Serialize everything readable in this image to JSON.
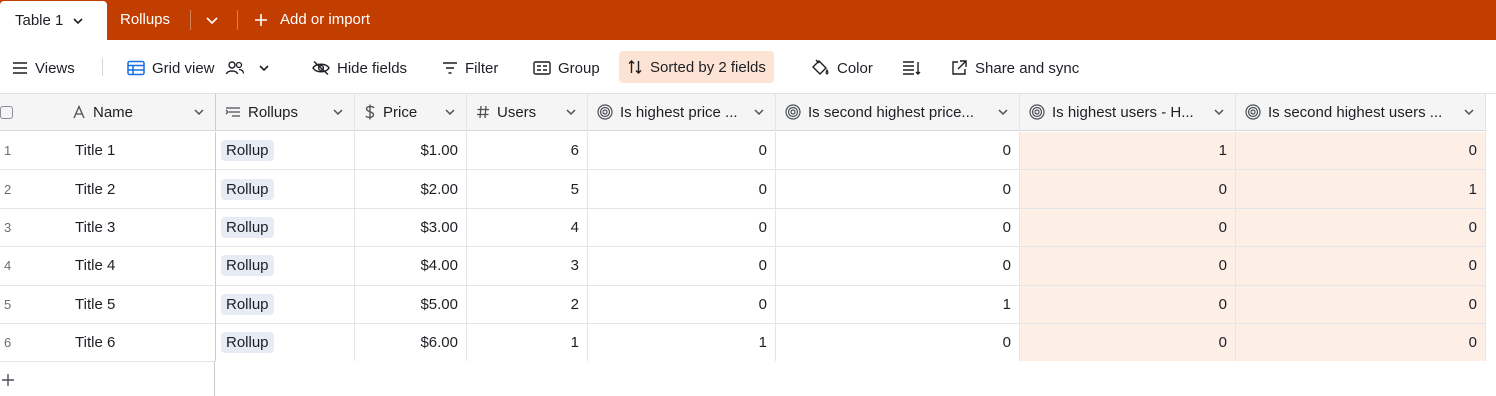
{
  "tabs": {
    "active": "Table 1",
    "inactive": "Rollups",
    "add_import": "Add or import"
  },
  "toolbar": {
    "views": "Views",
    "grid_view": "Grid view",
    "hide_fields": "Hide fields",
    "filter": "Filter",
    "group": "Group",
    "sorted": "Sorted by 2 fields",
    "color": "Color",
    "share_sync": "Share and sync"
  },
  "columns": [
    {
      "label": "Name",
      "icon": "text-icon"
    },
    {
      "label": "Rollups",
      "icon": "link-icon"
    },
    {
      "label": "Price",
      "icon": "currency-icon"
    },
    {
      "label": "Users",
      "icon": "number-icon"
    },
    {
      "label": "Is highest price ...",
      "icon": "formula-icon"
    },
    {
      "label": "Is second highest price...",
      "icon": "formula-icon"
    },
    {
      "label": "Is highest users - H...",
      "icon": "formula-icon"
    },
    {
      "label": "Is second highest users ...",
      "icon": "formula-icon"
    }
  ],
  "rows": [
    {
      "n": "1",
      "name": "Title 1",
      "rollup": "Rollup",
      "price": "$1.00",
      "users": "6",
      "hp": "0",
      "shp": "0",
      "hu": "1",
      "shu": "0"
    },
    {
      "n": "2",
      "name": "Title 2",
      "rollup": "Rollup",
      "price": "$2.00",
      "users": "5",
      "hp": "0",
      "shp": "0",
      "hu": "0",
      "shu": "1"
    },
    {
      "n": "3",
      "name": "Title 3",
      "rollup": "Rollup",
      "price": "$3.00",
      "users": "4",
      "hp": "0",
      "shp": "0",
      "hu": "0",
      "shu": "0"
    },
    {
      "n": "4",
      "name": "Title 4",
      "rollup": "Rollup",
      "price": "$4.00",
      "users": "3",
      "hp": "0",
      "shp": "0",
      "hu": "0",
      "shu": "0"
    },
    {
      "n": "5",
      "name": "Title 5",
      "rollup": "Rollup",
      "price": "$5.00",
      "users": "2",
      "hp": "0",
      "shp": "1",
      "hu": "0",
      "shu": "0"
    },
    {
      "n": "6",
      "name": "Title 6",
      "rollup": "Rollup",
      "price": "$6.00",
      "users": "1",
      "hp": "1",
      "shp": "0",
      "hu": "0",
      "shu": "0"
    }
  ],
  "colors": {
    "tabbar": "#c13e00",
    "sorted_bg": "#fde3d4",
    "highlight": "#fdeee6",
    "chip": "#e6ebf4"
  }
}
